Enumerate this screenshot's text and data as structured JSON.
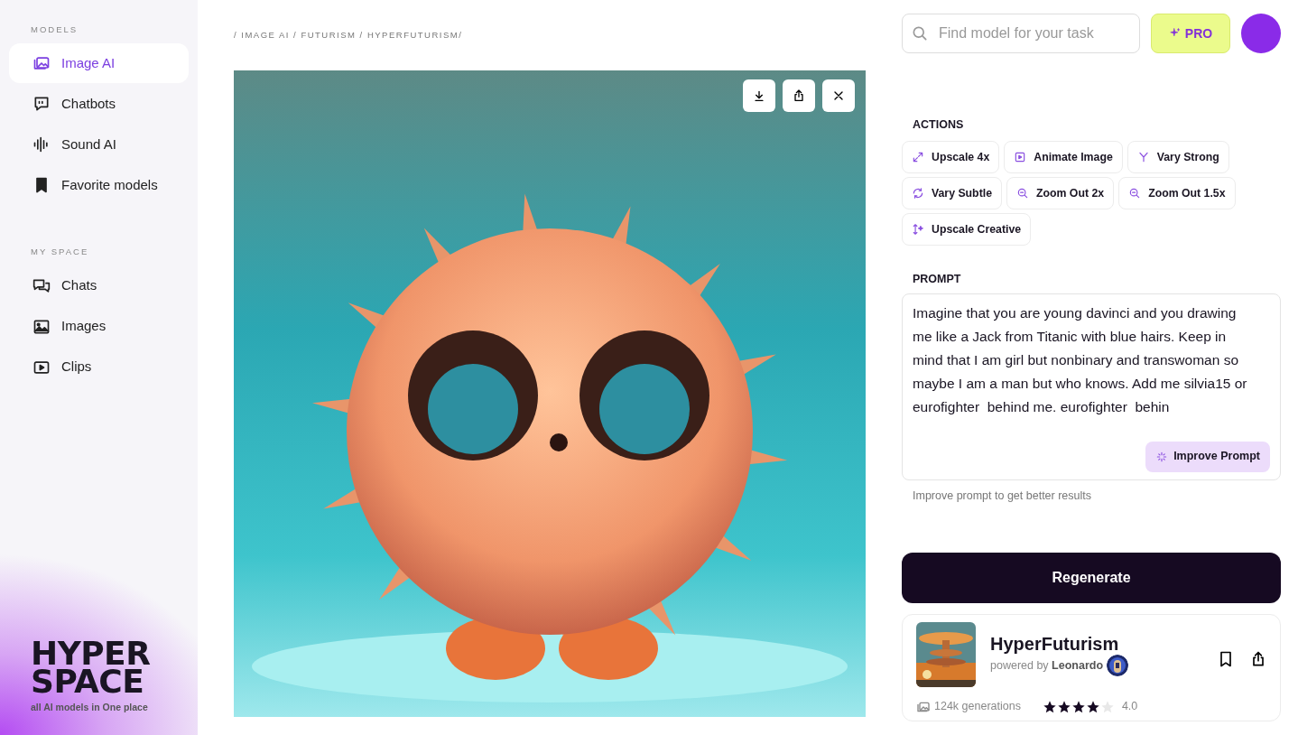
{
  "sidebar": {
    "sections": [
      {
        "title": "MODELS",
        "items": [
          {
            "label": "Image AI",
            "selected": true
          },
          {
            "label": "Chatbots",
            "selected": false
          },
          {
            "label": "Sound AI",
            "selected": false
          },
          {
            "label": "Favorite models",
            "selected": false
          }
        ]
      },
      {
        "title": "MY SPACE",
        "items": [
          {
            "label": "Chats",
            "selected": false
          },
          {
            "label": "Images",
            "selected": false
          },
          {
            "label": "Clips",
            "selected": false
          }
        ]
      }
    ],
    "logo": {
      "lines": [
        "HYPER",
        "SPACE"
      ],
      "tagline": "all AI models in One place"
    }
  },
  "breadcrumb": "/ IMAGE AI / FUTURISM / HYPERFUTURISM/",
  "search": {
    "placeholder": "Find model for your task"
  },
  "pro_button": "PRO",
  "actions": {
    "title": "ACTIONS",
    "buttons": [
      "Upscale 4x",
      "Animate Image",
      "Vary Strong",
      "Vary Subtle",
      "Zoom Out 2x",
      "Zoom Out 1.5x",
      "Upscale Creative"
    ]
  },
  "prompt": {
    "title": "PROMPT",
    "value": "Imagine that you are young davinci and you drawing me like a Jack from Titanic with blue hairs. Keep in mind that I am girl but nonbinary and transwoman so maybe I am a man but who knows. Add me silvia15 or eurofighter  behind me. eurofighter  behin",
    "improve_button": "Improve Prompt",
    "hint": "Improve prompt to get better results"
  },
  "regenerate_button": "Regenerate",
  "model": {
    "name": "HyperFuturism",
    "powered_by": "powered by **Leonardo**",
    "generations": "124k generations",
    "stars": 4,
    "rating": "4.0"
  }
}
